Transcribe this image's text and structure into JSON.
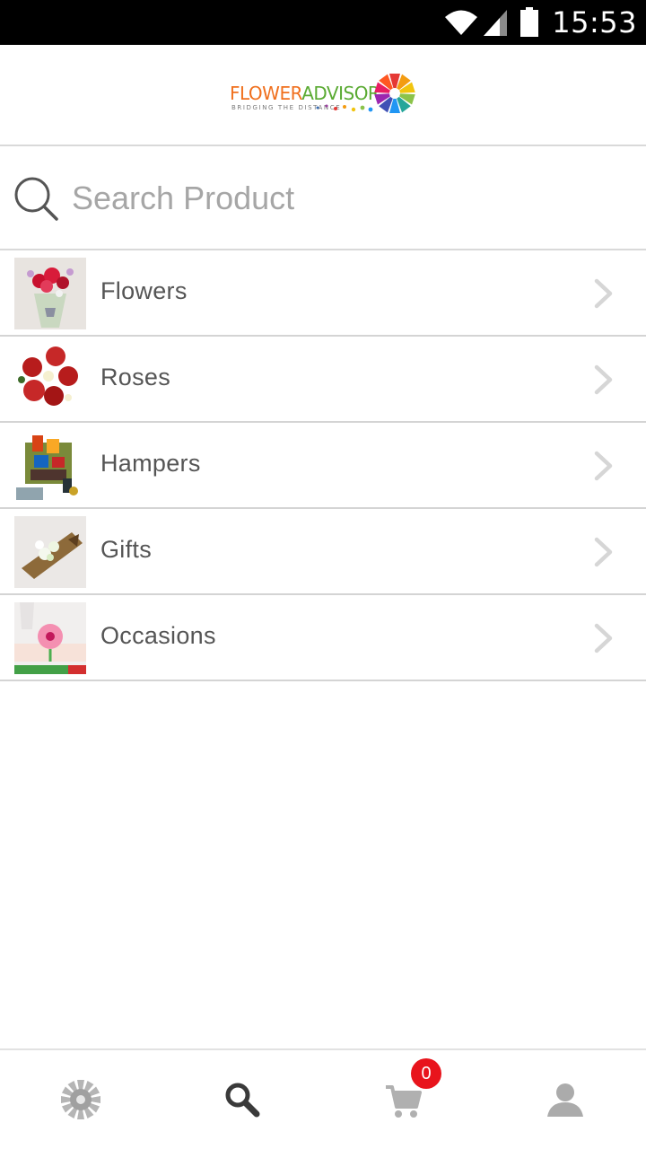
{
  "status_bar": {
    "time": "15:53",
    "icons": [
      "wifi-icon",
      "cell-signal-icon",
      "battery-icon"
    ]
  },
  "header": {
    "logo_text_part1": "FLOWER",
    "logo_text_part2": "ADVISOR",
    "logo_tagline": "BRIDGING THE DISTANCE"
  },
  "search": {
    "placeholder": "Search Product",
    "value": ""
  },
  "categories": [
    {
      "label": "Flowers",
      "icon": "flowers-thumbnail"
    },
    {
      "label": "Roses",
      "icon": "roses-thumbnail"
    },
    {
      "label": "Hampers",
      "icon": "hampers-thumbnail"
    },
    {
      "label": "Gifts",
      "icon": "gifts-thumbnail"
    },
    {
      "label": "Occasions",
      "icon": "occasions-thumbnail"
    }
  ],
  "bottom_nav": {
    "items": [
      "home-flower-icon",
      "search-icon",
      "cart-icon",
      "account-icon"
    ],
    "cart_count": "0",
    "active": "search"
  },
  "colors": {
    "brand_orange": "#f0701e",
    "brand_green": "#5aaa32",
    "badge_red": "#e8141c",
    "divider": "#d9d9d9",
    "text_gray": "#555555",
    "placeholder_gray": "#a6a6a6"
  }
}
